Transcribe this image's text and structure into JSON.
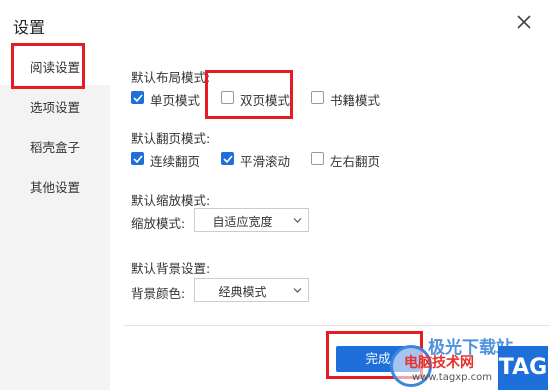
{
  "dialog": {
    "title": "设置",
    "close_icon": "close-icon"
  },
  "sidebar": {
    "items": [
      {
        "label": "阅读设置",
        "active": true
      },
      {
        "label": "选项设置",
        "active": false
      },
      {
        "label": "稻壳盒子",
        "active": false
      },
      {
        "label": "其他设置",
        "active": false
      }
    ]
  },
  "layout_mode": {
    "label": "默认布局模式:",
    "options": [
      {
        "label": "单页模式",
        "checked": true
      },
      {
        "label": "双页模式",
        "checked": false
      },
      {
        "label": "书籍模式",
        "checked": false
      }
    ]
  },
  "flip_mode": {
    "label": "默认翻页模式:",
    "options": [
      {
        "label": "连续翻页",
        "checked": true
      },
      {
        "label": "平滑滚动",
        "checked": true
      },
      {
        "label": "左右翻页",
        "checked": false
      }
    ]
  },
  "zoom_mode": {
    "label": "默认缩放模式:",
    "field_label": "缩放模式:",
    "value": "自适应宽度"
  },
  "background": {
    "label": "默认背景设置:",
    "field_label": "背景颜色:",
    "value": "经典模式"
  },
  "done_button": {
    "label": "完成"
  },
  "watermark": {
    "line1": "极光下载站",
    "line2": "电脑技术网",
    "url": "www.tagxp.com",
    "tag": "TAG"
  },
  "colors": {
    "accent": "#1e6fd9",
    "highlight_box": "#e51c23",
    "sidebar_bg": "#f3f3f3"
  }
}
